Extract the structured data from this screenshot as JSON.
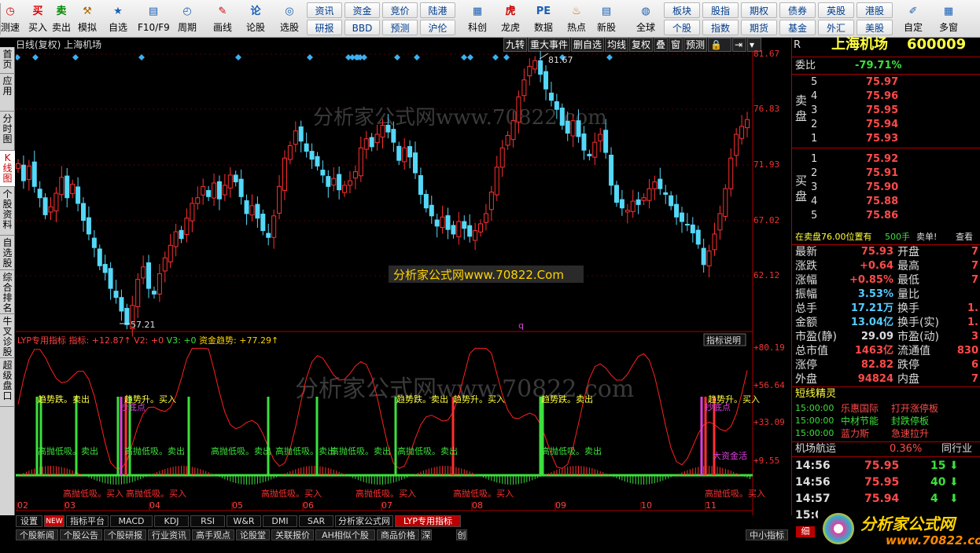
{
  "toolbar": {
    "left": [
      [
        "测速",
        "◷"
      ],
      [
        "买入",
        "买"
      ],
      [
        "卖出",
        "卖"
      ],
      [
        "模拟",
        "⚒"
      ],
      [
        "自选",
        "★"
      ],
      [
        "F10/F9",
        "▤"
      ],
      [
        "周期",
        "◴"
      ],
      [
        "画线",
        "✎"
      ],
      [
        "论股",
        "论"
      ],
      [
        "选股",
        "◎"
      ]
    ],
    "grid1": [
      "资讯",
      "资金",
      "竞价",
      "陆港",
      "研报",
      "BBD",
      "预测",
      "沪伦"
    ],
    "mid": [
      [
        "科创",
        "▦"
      ],
      [
        "龙虎",
        "虎"
      ],
      [
        "数据",
        "PE"
      ],
      [
        "热点",
        "♨"
      ],
      [
        "新股",
        "▤"
      ],
      [
        "全球",
        "◍"
      ]
    ],
    "grid2": [
      "板块",
      "股指",
      "期权",
      "债券",
      "英股",
      "港股",
      "个股",
      "指数",
      "期货",
      "基金",
      "外汇",
      "美股"
    ],
    "right": [
      [
        "自定",
        "✐"
      ],
      [
        "多窗",
        "▦"
      ]
    ]
  },
  "colors": {
    "up": "#ff3030",
    "down": "#55d8f8",
    "ma": "#ff3030",
    "buy": "#40e040",
    "sell": "#ff3030",
    "accent": "#ffff40"
  },
  "sidebar": [
    "首页",
    "应用",
    "分时图",
    "K线图",
    "个股资料",
    "自选股",
    "综合排名",
    "牛叉诊股",
    "超级盘口"
  ],
  "chart": {
    "title": "日线(复权) 上海机场",
    "tools": [
      "九转",
      "重大事件",
      "删自选",
      "均线",
      "复权",
      "叠",
      "窗",
      "预测",
      "🔒",
      "⇥",
      "▾"
    ],
    "yticks": [
      "81.67",
      "76.83",
      "71.93",
      "67.02",
      "62.12"
    ],
    "high_label": "81.67",
    "low_label": "57.21",
    "watermark": "分析家公式网www.70822.com",
    "banner": "分析家公式网www.70822.Com",
    "ind_title": "LYP专用指标",
    "ind_values": [
      "指标: +12.87↑",
      "V2: +0",
      "V3: +0",
      "资金趋势: +77.29↑"
    ],
    "ind_button": "指标说明",
    "ind_ticks": [
      "+80.19",
      "+56.64",
      "+33.09",
      "+9.55"
    ],
    "month_labels": [
      "02",
      "03",
      "04",
      "05",
      "06",
      "07",
      "08",
      "09",
      "10",
      "11"
    ],
    "mark_q": "q",
    "sig_up": "趋势升。买入",
    "sig_down": "趋势跌。卖出",
    "sig_mid": "高抛低吸。卖出",
    "sig_low": "高抛低吸。买入",
    "sig_dx": "抄底点",
    "sig_big": "大资金活"
  },
  "stock": {
    "name": "上海机场",
    "code": "600009"
  },
  "panel": {
    "r": "R",
    "webi_label": "委比",
    "webi": "-79.71%",
    "sell_side": "卖盘",
    "buy_side": "买盘",
    "sell": [
      [
        "5",
        "75.97"
      ],
      [
        "4",
        "75.96"
      ],
      [
        "3",
        "75.95"
      ],
      [
        "2",
        "75.94"
      ],
      [
        "1",
        "75.93"
      ]
    ],
    "buy": [
      [
        "1",
        "75.92"
      ],
      [
        "2",
        "75.91"
      ],
      [
        "3",
        "75.90"
      ],
      [
        "4",
        "75.88"
      ],
      [
        "5",
        "75.86"
      ]
    ],
    "notice": "在卖盘76.00位置有",
    "notice_qty": "500手",
    "notice_act": "卖单!",
    "notice_view": "查看",
    "quotes": [
      [
        "最新",
        "75.93",
        "开盘",
        "7"
      ],
      [
        "涨跌",
        "+0.64",
        "最高",
        "7"
      ],
      [
        "涨幅",
        "+0.85%",
        "最低",
        "7"
      ],
      [
        "振幅",
        "3.53%",
        "量比",
        ""
      ],
      [
        "总手",
        "17.21万",
        "换手",
        "1."
      ],
      [
        "金额",
        "13.04亿",
        "换手(实)",
        "1."
      ],
      [
        "市盈(静)",
        "29.09",
        "市盈(动)",
        "3"
      ],
      [
        "总市值",
        "1463亿",
        "流通值",
        "830"
      ],
      [
        "涨停",
        "82.82",
        "跌停",
        "6"
      ],
      [
        "外盘",
        "94824",
        "内盘",
        "7"
      ]
    ],
    "elves_title": "短线精灵",
    "elves": [
      [
        "15:00:00",
        "乐惠国际",
        "打开涨停板"
      ],
      [
        "15:00:00",
        "中材节能",
        "封跌停板"
      ],
      [
        "15:00:00",
        "蓝力斯",
        "急速拉升"
      ]
    ],
    "flash": "机场航运",
    "flash_pct": "0.36%",
    "flash_rank": "同行业",
    "ticks": [
      [
        "14:56",
        "75.95",
        "15"
      ],
      [
        "14:56",
        "75.95",
        "40"
      ],
      [
        "14:57",
        "75.94",
        "4"
      ],
      [
        "15:00",
        "",
        ""
      ]
    ],
    "logo": "分析家公式网",
    "logo_url": "www.70822.com"
  },
  "tabs": [
    "设置",
    "NEW",
    "指标平台",
    "MACD",
    "KDJ",
    "RSI",
    "W&R",
    "DMI",
    "SAR",
    "分析家公式网",
    "LYP专用指标"
  ],
  "bottom": [
    "个股新闻",
    "个股公告",
    "个股研报",
    "行业资讯",
    "高手观点",
    "论股堂",
    "关联报价",
    "AH相似个股",
    "商品价格",
    "深",
    "创",
    "中小指标"
  ],
  "detail_tab": "细"
}
